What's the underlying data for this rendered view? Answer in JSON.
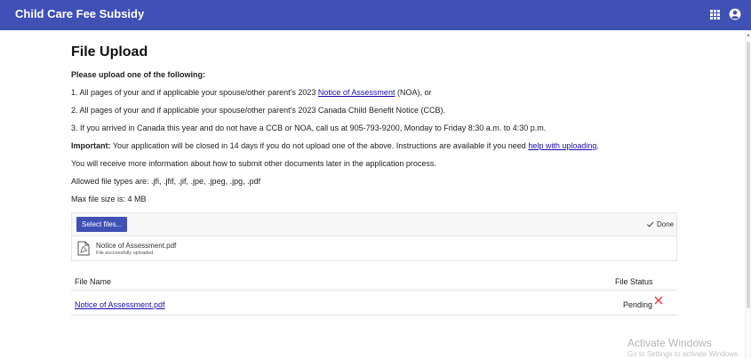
{
  "app": {
    "title": "Child Care Fee Subsidy"
  },
  "page": {
    "title": "File Upload",
    "intro": "Please upload one of the following:",
    "item1_pre": "1. All pages of your and if applicable your spouse/other parent's 2023 ",
    "item1_link": "Notice of Assessment",
    "item1_post": " (NOA), or",
    "item2": "2. All pages of your and if applicable your spouse/other parent's 2023 Canada Child Benefit Notice (CCB).",
    "item3": "3.  If you arrived in Canada this year and do not have a CCB or NOA, call us at 905-793-9200, Monday to Friday 8:30 a.m. to 4:30 p.m.",
    "important_label": "Important:",
    "important_text": " Your application will be closed in 14 days if you do not upload one of the above.  Instructions are available if you need ",
    "important_link": "help with uploading",
    "important_end": ".",
    "more_info": "You will receive more information about how to submit other documents later in the application process.",
    "allowed_types": "Allowed file types are: .jfi, .jfif, .jif, .jpe, .jpeg, .jpg, .pdf",
    "max_size": "Max file size is: 4 MB"
  },
  "upload": {
    "select_label": "Select files...",
    "status_label": "Done",
    "file_name": "Notice of Assessment.pdf",
    "file_message": "File successfully uploaded."
  },
  "table": {
    "columns": [
      "File Name",
      "File Status"
    ],
    "rows": [
      {
        "name": "Notice of Assessment.pdf",
        "status": "Pending"
      }
    ]
  },
  "watermark": {
    "title": "Activate Windows",
    "subtitle": "Go to Settings to activate Windows."
  },
  "colors": {
    "primary": "#3f51b5",
    "link": "#1a0dab",
    "remove": "#e53935"
  },
  "icons": [
    "apps-grid-icon",
    "account-circle-icon",
    "check-icon",
    "pdf-file-icon",
    "remove-x-icon"
  ]
}
